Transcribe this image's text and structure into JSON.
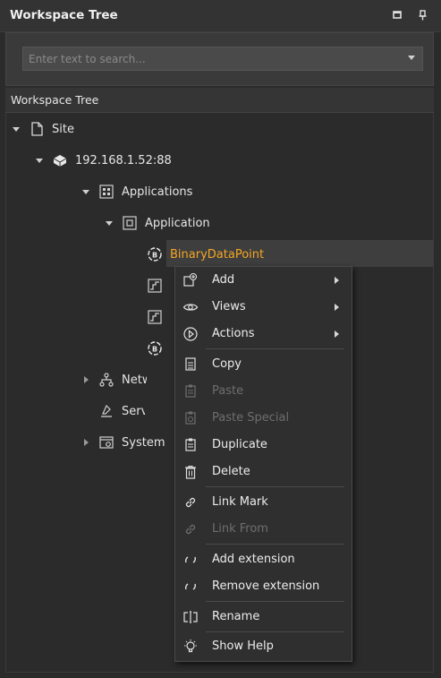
{
  "panel": {
    "title": "Workspace Tree",
    "search_placeholder": "Enter text to search...",
    "tree_header": "Workspace Tree"
  },
  "tree": {
    "site": "Site",
    "ip": "192.168.1.52:88",
    "applications": "Applications",
    "application": "Application",
    "binary_point": "BinaryDataPoint",
    "networks": "Networks",
    "services": "Services",
    "system": "System"
  },
  "context_menu": {
    "add": "Add",
    "views": "Views",
    "actions": "Actions",
    "copy": "Copy",
    "paste": "Paste",
    "paste_special": "Paste Special",
    "duplicate": "Duplicate",
    "delete": "Delete",
    "link_mark": "Link Mark",
    "link_from": "Link From",
    "add_extension": "Add extension",
    "remove_extension": "Remove extension",
    "rename": "Rename",
    "show_help": "Show Help"
  },
  "colors": {
    "selected_text": "#f5a623",
    "background": "#2b2b2b",
    "menu_background": "#2f2f2f"
  },
  "icons": [
    "maximize-icon",
    "pin-icon",
    "page-icon",
    "server-icon",
    "apps-icon",
    "app-icon",
    "binary-point-icon",
    "numeric-point-icon",
    "network-icon",
    "services-icon",
    "system-icon"
  ]
}
